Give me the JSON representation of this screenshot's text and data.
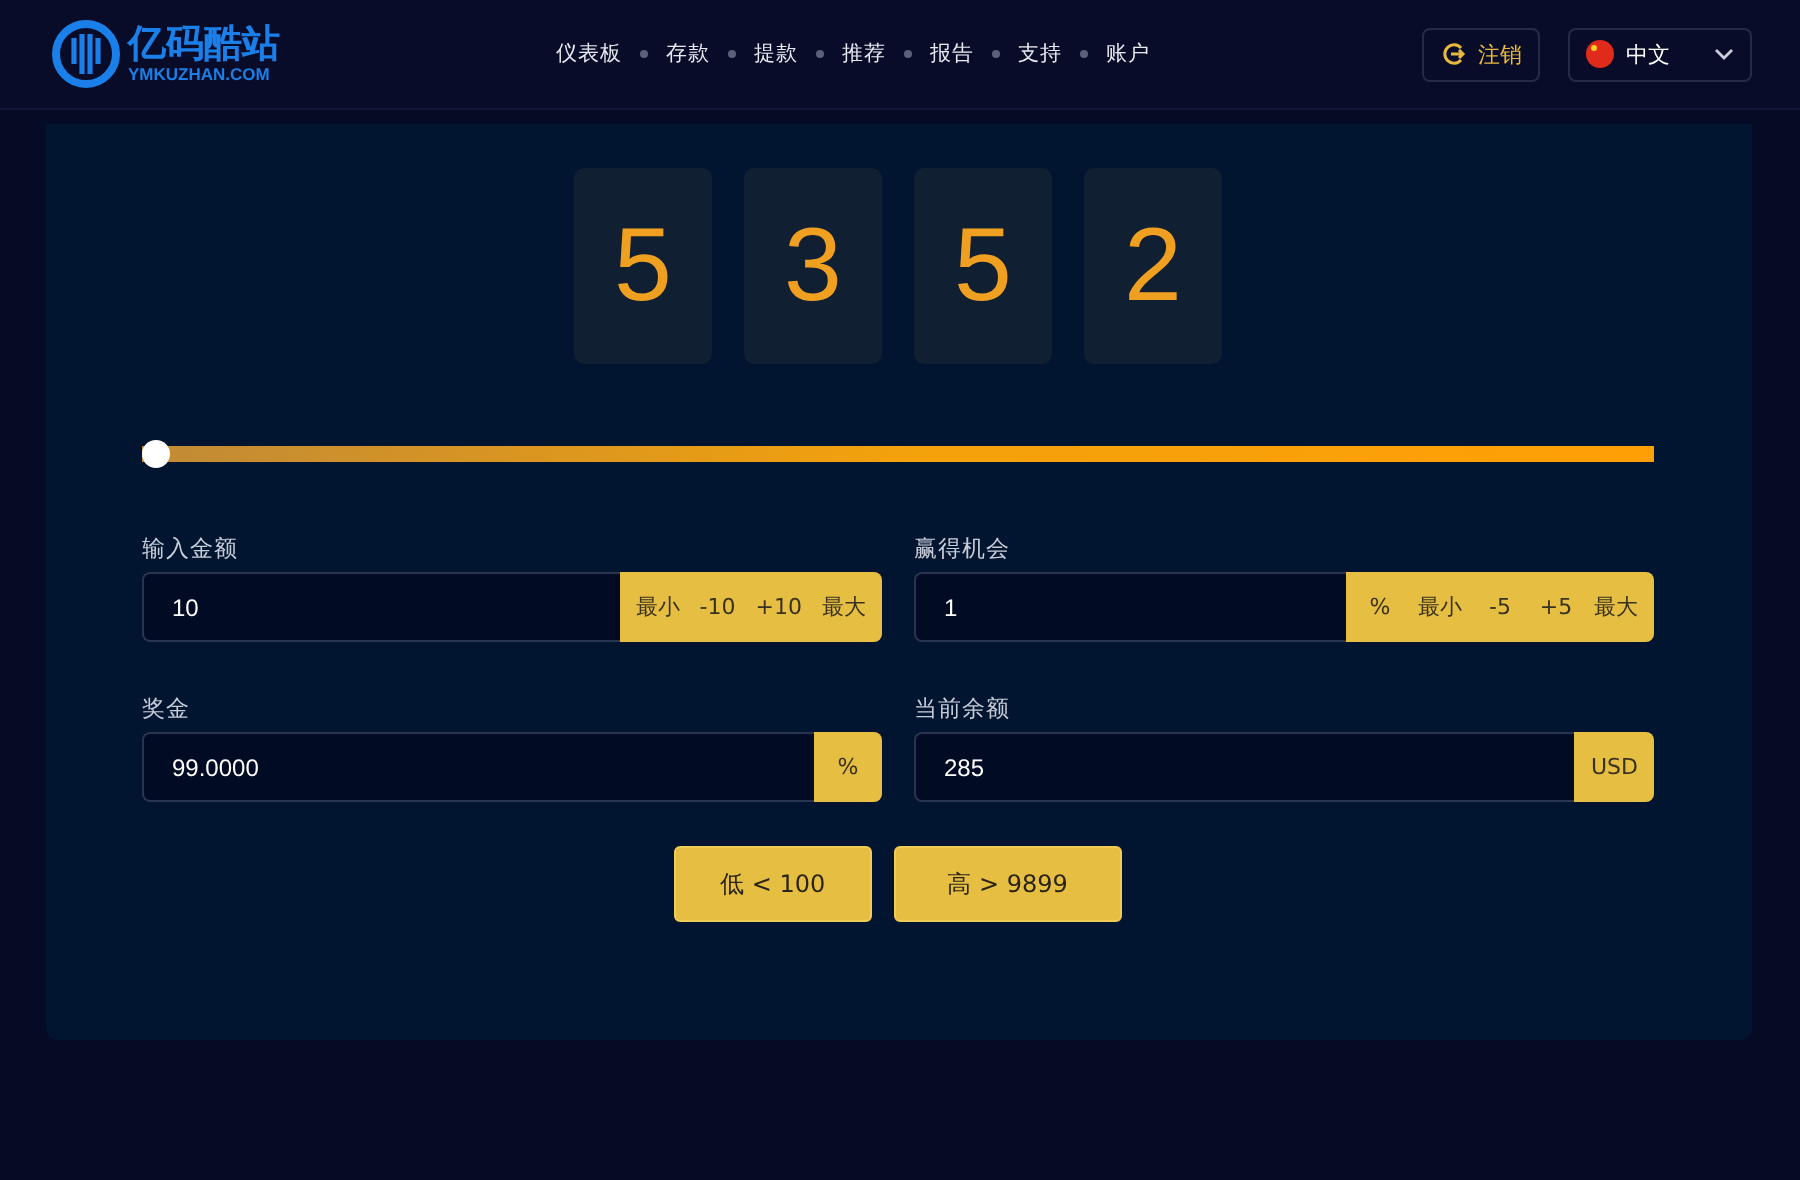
{
  "header": {
    "logo": {
      "title": "亿码酷站",
      "subtitle": "YMKUZHAN.COM"
    },
    "nav": [
      {
        "label": "仪表板"
      },
      {
        "label": "存款"
      },
      {
        "label": "提款"
      },
      {
        "label": "推荐"
      },
      {
        "label": "报告"
      },
      {
        "label": "支持"
      },
      {
        "label": "账户"
      }
    ],
    "logout_button": "注销",
    "language": "中文"
  },
  "digits": [
    "5",
    "3",
    "5",
    "2"
  ],
  "slider": {
    "level": 0
  },
  "fields": [
    {
      "label": "输入金额",
      "value": "10",
      "addons": [
        "最小",
        "-10",
        "+10",
        "最大"
      ]
    },
    {
      "label": "赢得机会",
      "value": "1",
      "addons": [
        "%",
        "最小",
        "-5",
        "+5",
        "最大"
      ]
    },
    {
      "label": "奖金",
      "value": "99.0000",
      "addons": [
        "%"
      ]
    },
    {
      "label": "当前余额",
      "value": "285",
      "addons": [
        "USD"
      ]
    }
  ],
  "buttons": [
    "低 < 100",
    "高 > 9899"
  ]
}
